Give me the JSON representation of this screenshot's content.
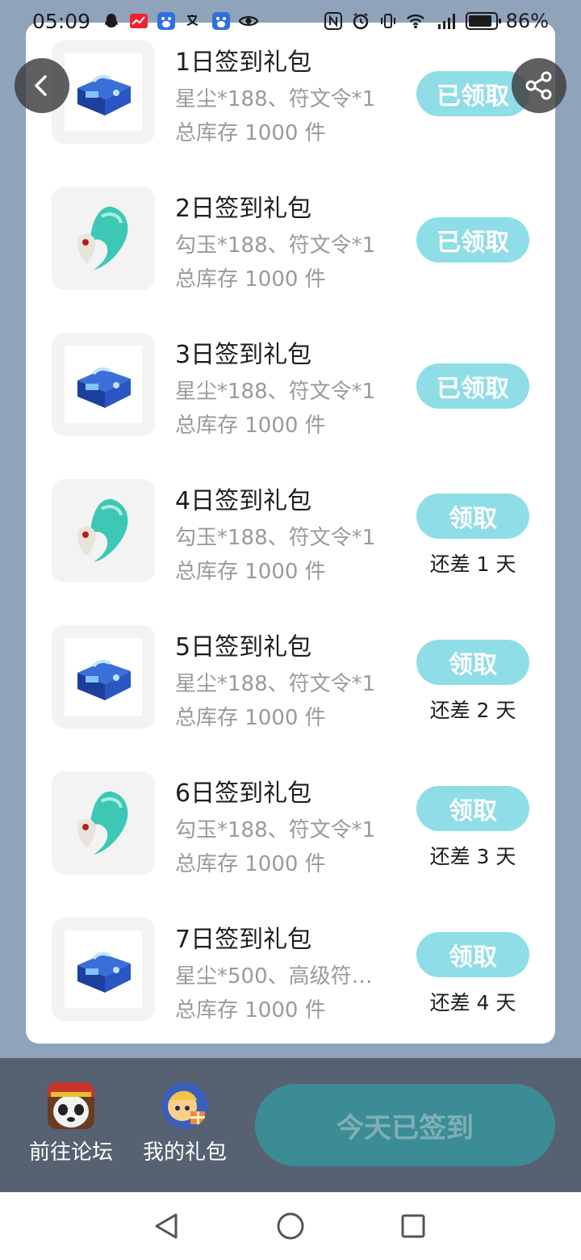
{
  "status_bar": {
    "time": "05:09",
    "battery": "86%",
    "network": "4G"
  },
  "gifts": [
    {
      "title": "1日签到礼包",
      "contents": "星尘*188、符文令*1",
      "stock": "总库存 1000 件",
      "button": "已领取",
      "days_left": "",
      "icon": "treasure-chest-icon"
    },
    {
      "title": "2日签到礼包",
      "contents": "勾玉*188、符文令*1",
      "stock": "总库存 1000 件",
      "button": "已领取",
      "days_left": "",
      "icon": "jade-magatama-icon"
    },
    {
      "title": "3日签到礼包",
      "contents": "星尘*188、符文令*1",
      "stock": "总库存 1000 件",
      "button": "已领取",
      "days_left": "",
      "icon": "treasure-chest-icon"
    },
    {
      "title": "4日签到礼包",
      "contents": "勾玉*188、符文令*1",
      "stock": "总库存 1000 件",
      "button": "领取",
      "days_left": "还差 1 天",
      "icon": "jade-magatama-icon"
    },
    {
      "title": "5日签到礼包",
      "contents": "星尘*188、符文令*1",
      "stock": "总库存 1000 件",
      "button": "领取",
      "days_left": "还差 2 天",
      "icon": "treasure-chest-icon"
    },
    {
      "title": "6日签到礼包",
      "contents": "勾玉*188、符文令*1",
      "stock": "总库存 1000 件",
      "button": "领取",
      "days_left": "还差 3 天",
      "icon": "jade-magatama-icon"
    },
    {
      "title": "7日签到礼包",
      "contents": "星尘*500、高级符…",
      "stock": "总库存 1000 件",
      "button": "领取",
      "days_left": "还差 4 天",
      "icon": "treasure-chest-icon"
    }
  ],
  "bottom_bar": {
    "forum_label": "前往论坛",
    "my_gifts_label": "我的礼包",
    "signed_button": "今天已签到"
  },
  "colors": {
    "background": "#8fa3bb",
    "claim_button": "#8fdde6",
    "bottom_bar": "#566272",
    "signed_button": "#3c8c96"
  }
}
